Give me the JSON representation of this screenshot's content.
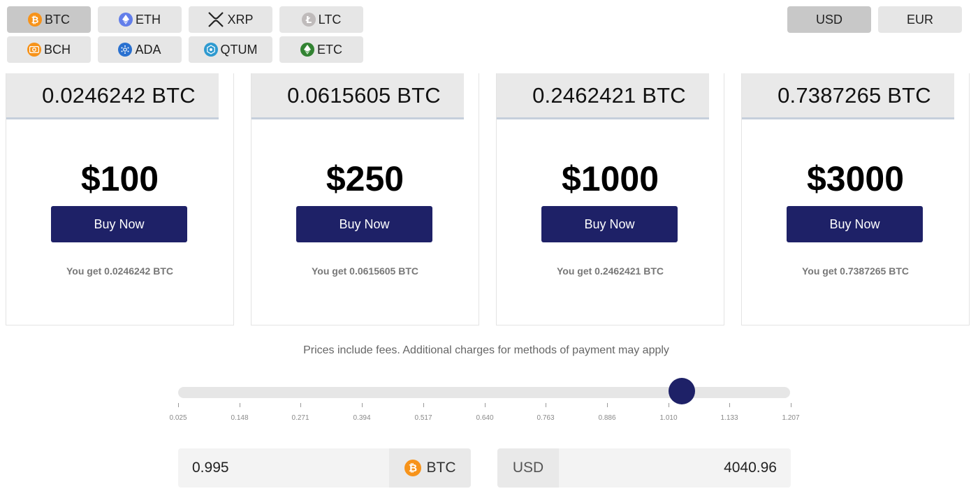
{
  "coins": [
    {
      "label": "BTC",
      "icon": "bitcoin-icon",
      "color": "#f7931a",
      "active": true
    },
    {
      "label": "ETH",
      "icon": "ethereum-icon",
      "color": "#627eea",
      "active": false
    },
    {
      "label": "XRP",
      "icon": "ripple-icon",
      "color": "#222222",
      "active": false
    },
    {
      "label": "LTC",
      "icon": "litecoin-icon",
      "color": "#bfbbbb",
      "active": false
    },
    {
      "label": "BCH",
      "icon": "bitcoin-cash-icon",
      "color": "#f7931a",
      "active": false
    },
    {
      "label": "ADA",
      "icon": "cardano-icon",
      "color": "#2a71d0",
      "active": false
    },
    {
      "label": "QTUM",
      "icon": "qtum-icon",
      "color": "#2e9ad0",
      "active": false
    },
    {
      "label": "ETC",
      "icon": "ethereum-classic-icon",
      "color": "#328332",
      "active": false
    }
  ],
  "currencies": [
    {
      "label": "USD",
      "active": true
    },
    {
      "label": "EUR",
      "active": false
    }
  ],
  "cards": [
    {
      "crypto_amount": "0.0246242 BTC",
      "price": "$100",
      "buy_label": "Buy Now",
      "you_get": "You get 0.0246242 BTC"
    },
    {
      "crypto_amount": "0.0615605 BTC",
      "price": "$250",
      "buy_label": "Buy Now",
      "you_get": "You get 0.0615605 BTC"
    },
    {
      "crypto_amount": "0.2462421 BTC",
      "price": "$1000",
      "buy_label": "Buy Now",
      "you_get": "You get 0.2462421 BTC"
    },
    {
      "crypto_amount": "0.7387265 BTC",
      "price": "$3000",
      "buy_label": "Buy Now",
      "you_get": "You get 0.7387265 BTC"
    }
  ],
  "note": "Prices include fees. Additional charges for methods of payment may apply",
  "slider": {
    "ticks": [
      "0.025",
      "0.148",
      "0.271",
      "0.394",
      "0.517",
      "0.640",
      "0.763",
      "0.886",
      "1.010",
      "1.133",
      "1.207"
    ],
    "min": 0.025,
    "max": 1.207,
    "value": 0.995
  },
  "converter": {
    "crypto_value": "0.995",
    "crypto_unit": "BTC",
    "fiat_unit": "USD",
    "fiat_value": "4040.96"
  },
  "colors": {
    "accent": "#1e2167",
    "btc_orange": "#f7931a"
  }
}
